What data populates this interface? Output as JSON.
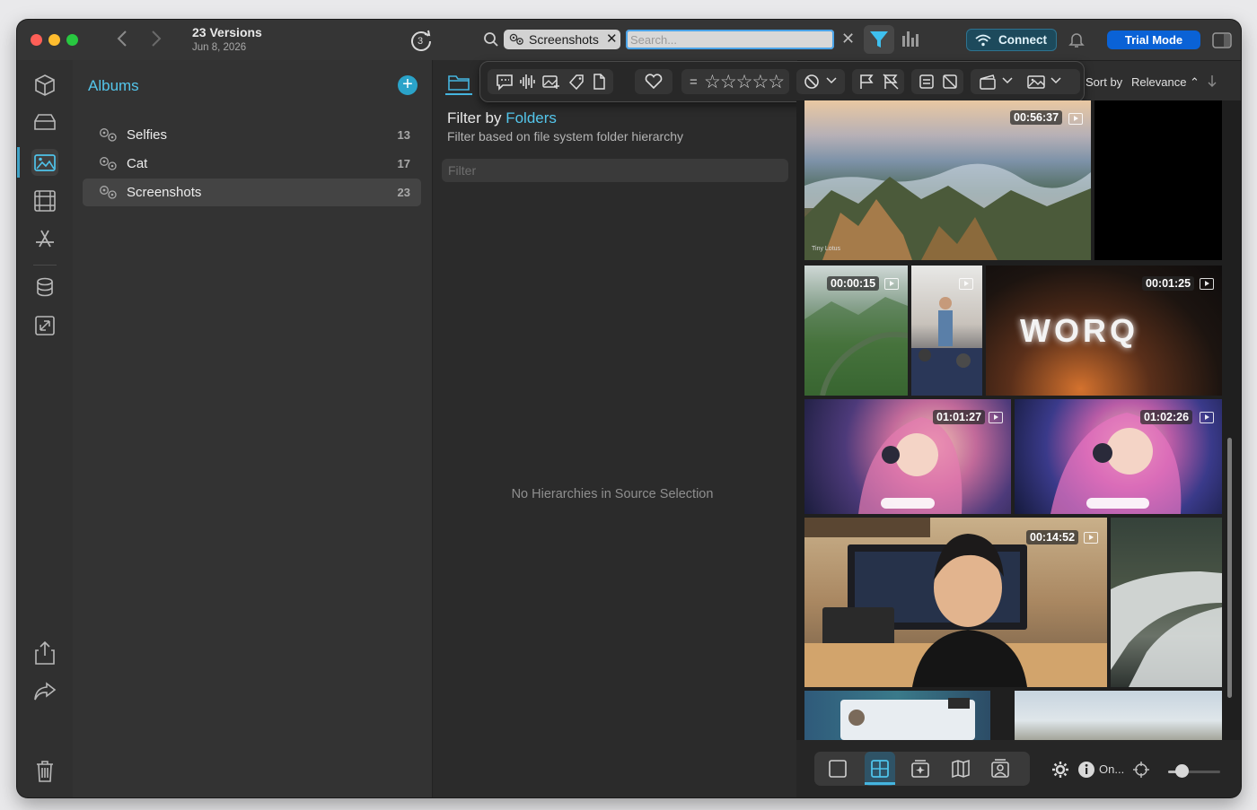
{
  "window": {
    "title": "23 Versions",
    "subtitle": "Jun 8, 2026",
    "sync_badge": "3"
  },
  "search": {
    "token_label": "Screenshots",
    "placeholder": "Search..."
  },
  "toolbar": {
    "connect_label": "Connect",
    "trial_label": "Trial Mode"
  },
  "rail": {
    "icons": [
      "cube-icon",
      "drive-icon",
      "photos-icon",
      "film-icon",
      "appstore-icon",
      "database-icon",
      "import-icon",
      "share-icon",
      "forward-icon",
      "trash-icon"
    ]
  },
  "albums": {
    "title": "Albums",
    "items": [
      {
        "name": "Selfies",
        "count": "13"
      },
      {
        "name": "Cat",
        "count": "17"
      },
      {
        "name": "Screenshots",
        "count": "23"
      }
    ],
    "selected_index": 2
  },
  "filter": {
    "heading_prefix": "Filter by",
    "heading_accent": "Folders",
    "description": "Filter based on file system folder hierarchy",
    "input_placeholder": "Filter",
    "empty_message": "No Hierarchies in Source Selection",
    "rating_prefix": "=",
    "stars": "☆☆☆☆☆"
  },
  "sort": {
    "label": "Sort by",
    "value": "Relevance ⌃"
  },
  "grid": {
    "tiles": [
      {
        "label": "mountain-sea-of-clouds",
        "duration": "00:56:37",
        "caption": "Tiny Lotus"
      },
      {
        "label": "black-video",
        "duration": ""
      },
      {
        "label": "green-valley-bridge",
        "duration": "00:00:15"
      },
      {
        "label": "conference-room",
        "duration": ""
      },
      {
        "label": "worq-neon-sign",
        "duration": "00:01:25",
        "sign_text": "WORQ"
      },
      {
        "label": "anime-girl-headphones-1",
        "duration": "01:01:27"
      },
      {
        "label": "anime-girl-headphones-2",
        "duration": "01:02:26"
      },
      {
        "label": "man-at-desk",
        "duration": "00:14:52"
      },
      {
        "label": "dam-spillway",
        "duration": ""
      },
      {
        "label": "app-screenshot",
        "duration": ""
      },
      {
        "label": "sky-landscape",
        "duration": ""
      }
    ]
  },
  "bottombar": {
    "on_label": "On...",
    "zoom_level": 0.25
  }
}
